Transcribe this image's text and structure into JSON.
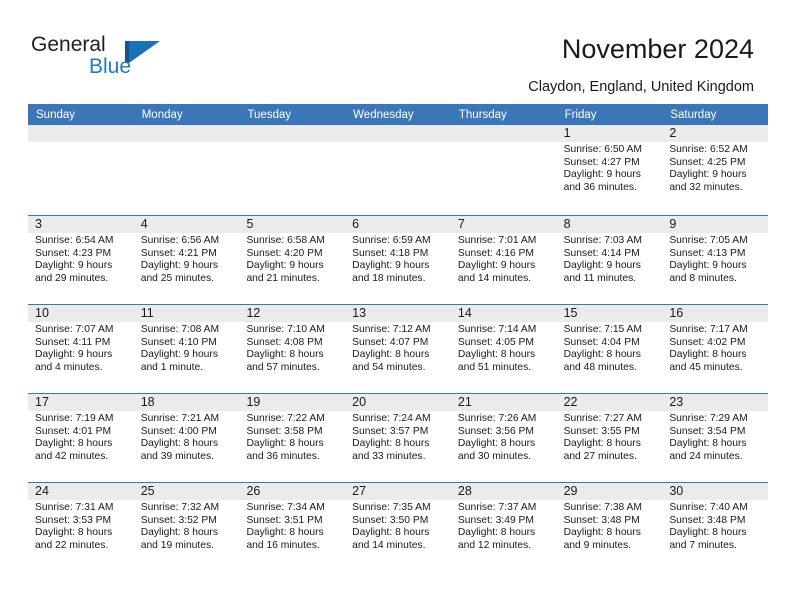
{
  "brand": {
    "name_top": "General",
    "name_bottom": "Blue",
    "logo_icon": "general-blue-flag-logo"
  },
  "header": {
    "title": "November 2024",
    "subtitle": "Claydon, England, United Kingdom"
  },
  "colors": {
    "header_blue": "#3a76b8",
    "daynum_band": "#ebebeb",
    "brand_blue": "#1e7bc4",
    "text": "#1a1a1a"
  },
  "calendar": {
    "weekdays": [
      "Sunday",
      "Monday",
      "Tuesday",
      "Wednesday",
      "Thursday",
      "Friday",
      "Saturday"
    ],
    "labels": {
      "sunrise": "Sunrise:",
      "sunset": "Sunset:",
      "daylight": "Daylight:"
    },
    "weeks": [
      [
        {
          "day": "",
          "l1": "",
          "l2": "",
          "l3": "",
          "l4": ""
        },
        {
          "day": "",
          "l1": "",
          "l2": "",
          "l3": "",
          "l4": ""
        },
        {
          "day": "",
          "l1": "",
          "l2": "",
          "l3": "",
          "l4": ""
        },
        {
          "day": "",
          "l1": "",
          "l2": "",
          "l3": "",
          "l4": ""
        },
        {
          "day": "",
          "l1": "",
          "l2": "",
          "l3": "",
          "l4": ""
        },
        {
          "day": "1",
          "l1": "Sunrise: 6:50 AM",
          "l2": "Sunset: 4:27 PM",
          "l3": "Daylight: 9 hours",
          "l4": "and 36 minutes."
        },
        {
          "day": "2",
          "l1": "Sunrise: 6:52 AM",
          "l2": "Sunset: 4:25 PM",
          "l3": "Daylight: 9 hours",
          "l4": "and 32 minutes."
        }
      ],
      [
        {
          "day": "3",
          "l1": "Sunrise: 6:54 AM",
          "l2": "Sunset: 4:23 PM",
          "l3": "Daylight: 9 hours",
          "l4": "and 29 minutes."
        },
        {
          "day": "4",
          "l1": "Sunrise: 6:56 AM",
          "l2": "Sunset: 4:21 PM",
          "l3": "Daylight: 9 hours",
          "l4": "and 25 minutes."
        },
        {
          "day": "5",
          "l1": "Sunrise: 6:58 AM",
          "l2": "Sunset: 4:20 PM",
          "l3": "Daylight: 9 hours",
          "l4": "and 21 minutes."
        },
        {
          "day": "6",
          "l1": "Sunrise: 6:59 AM",
          "l2": "Sunset: 4:18 PM",
          "l3": "Daylight: 9 hours",
          "l4": "and 18 minutes."
        },
        {
          "day": "7",
          "l1": "Sunrise: 7:01 AM",
          "l2": "Sunset: 4:16 PM",
          "l3": "Daylight: 9 hours",
          "l4": "and 14 minutes."
        },
        {
          "day": "8",
          "l1": "Sunrise: 7:03 AM",
          "l2": "Sunset: 4:14 PM",
          "l3": "Daylight: 9 hours",
          "l4": "and 11 minutes."
        },
        {
          "day": "9",
          "l1": "Sunrise: 7:05 AM",
          "l2": "Sunset: 4:13 PM",
          "l3": "Daylight: 9 hours",
          "l4": "and 8 minutes."
        }
      ],
      [
        {
          "day": "10",
          "l1": "Sunrise: 7:07 AM",
          "l2": "Sunset: 4:11 PM",
          "l3": "Daylight: 9 hours",
          "l4": "and 4 minutes."
        },
        {
          "day": "11",
          "l1": "Sunrise: 7:08 AM",
          "l2": "Sunset: 4:10 PM",
          "l3": "Daylight: 9 hours",
          "l4": "and 1 minute."
        },
        {
          "day": "12",
          "l1": "Sunrise: 7:10 AM",
          "l2": "Sunset: 4:08 PM",
          "l3": "Daylight: 8 hours",
          "l4": "and 57 minutes."
        },
        {
          "day": "13",
          "l1": "Sunrise: 7:12 AM",
          "l2": "Sunset: 4:07 PM",
          "l3": "Daylight: 8 hours",
          "l4": "and 54 minutes."
        },
        {
          "day": "14",
          "l1": "Sunrise: 7:14 AM",
          "l2": "Sunset: 4:05 PM",
          "l3": "Daylight: 8 hours",
          "l4": "and 51 minutes."
        },
        {
          "day": "15",
          "l1": "Sunrise: 7:15 AM",
          "l2": "Sunset: 4:04 PM",
          "l3": "Daylight: 8 hours",
          "l4": "and 48 minutes."
        },
        {
          "day": "16",
          "l1": "Sunrise: 7:17 AM",
          "l2": "Sunset: 4:02 PM",
          "l3": "Daylight: 8 hours",
          "l4": "and 45 minutes."
        }
      ],
      [
        {
          "day": "17",
          "l1": "Sunrise: 7:19 AM",
          "l2": "Sunset: 4:01 PM",
          "l3": "Daylight: 8 hours",
          "l4": "and 42 minutes."
        },
        {
          "day": "18",
          "l1": "Sunrise: 7:21 AM",
          "l2": "Sunset: 4:00 PM",
          "l3": "Daylight: 8 hours",
          "l4": "and 39 minutes."
        },
        {
          "day": "19",
          "l1": "Sunrise: 7:22 AM",
          "l2": "Sunset: 3:58 PM",
          "l3": "Daylight: 8 hours",
          "l4": "and 36 minutes."
        },
        {
          "day": "20",
          "l1": "Sunrise: 7:24 AM",
          "l2": "Sunset: 3:57 PM",
          "l3": "Daylight: 8 hours",
          "l4": "and 33 minutes."
        },
        {
          "day": "21",
          "l1": "Sunrise: 7:26 AM",
          "l2": "Sunset: 3:56 PM",
          "l3": "Daylight: 8 hours",
          "l4": "and 30 minutes."
        },
        {
          "day": "22",
          "l1": "Sunrise: 7:27 AM",
          "l2": "Sunset: 3:55 PM",
          "l3": "Daylight: 8 hours",
          "l4": "and 27 minutes."
        },
        {
          "day": "23",
          "l1": "Sunrise: 7:29 AM",
          "l2": "Sunset: 3:54 PM",
          "l3": "Daylight: 8 hours",
          "l4": "and 24 minutes."
        }
      ],
      [
        {
          "day": "24",
          "l1": "Sunrise: 7:31 AM",
          "l2": "Sunset: 3:53 PM",
          "l3": "Daylight: 8 hours",
          "l4": "and 22 minutes."
        },
        {
          "day": "25",
          "l1": "Sunrise: 7:32 AM",
          "l2": "Sunset: 3:52 PM",
          "l3": "Daylight: 8 hours",
          "l4": "and 19 minutes."
        },
        {
          "day": "26",
          "l1": "Sunrise: 7:34 AM",
          "l2": "Sunset: 3:51 PM",
          "l3": "Daylight: 8 hours",
          "l4": "and 16 minutes."
        },
        {
          "day": "27",
          "l1": "Sunrise: 7:35 AM",
          "l2": "Sunset: 3:50 PM",
          "l3": "Daylight: 8 hours",
          "l4": "and 14 minutes."
        },
        {
          "day": "28",
          "l1": "Sunrise: 7:37 AM",
          "l2": "Sunset: 3:49 PM",
          "l3": "Daylight: 8 hours",
          "l4": "and 12 minutes."
        },
        {
          "day": "29",
          "l1": "Sunrise: 7:38 AM",
          "l2": "Sunset: 3:48 PM",
          "l3": "Daylight: 8 hours",
          "l4": "and 9 minutes."
        },
        {
          "day": "30",
          "l1": "Sunrise: 7:40 AM",
          "l2": "Sunset: 3:48 PM",
          "l3": "Daylight: 8 hours",
          "l4": "and 7 minutes."
        }
      ]
    ]
  }
}
